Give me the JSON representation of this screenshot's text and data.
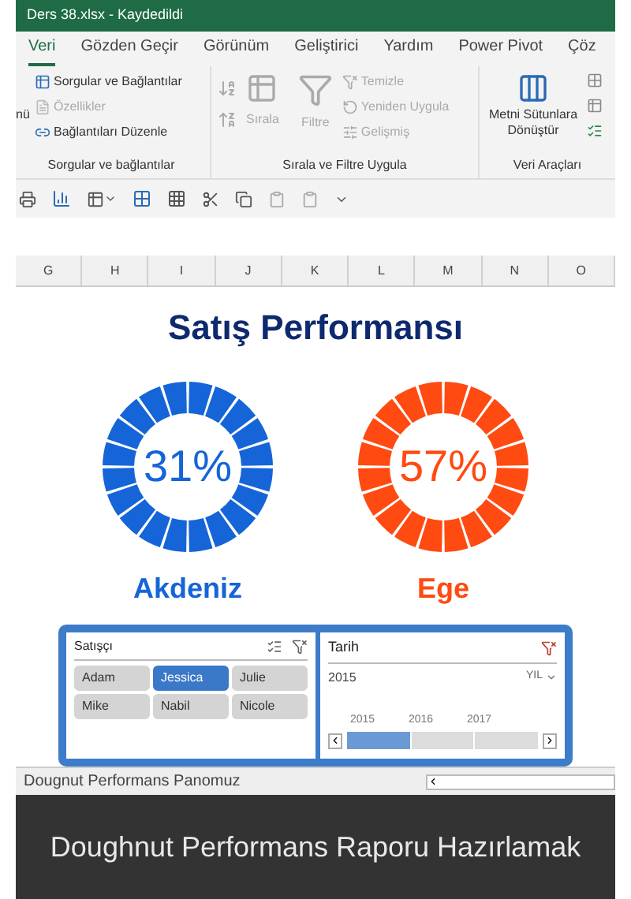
{
  "window": {
    "title": "Ders 38.xlsx - Kaydedildi"
  },
  "ribbon_tabs": [
    {
      "label": "Veri",
      "selected": true
    },
    {
      "label": "Gözden Geçir",
      "selected": false
    },
    {
      "label": "Görünüm",
      "selected": false
    },
    {
      "label": "Geliştirici",
      "selected": false
    },
    {
      "label": "Yardım",
      "selected": false
    },
    {
      "label": "Power Pivot",
      "selected": false
    },
    {
      "label": "Çöz",
      "selected": false
    }
  ],
  "ribbon": {
    "cut_label": "nü",
    "queries": {
      "title": "Sorgular ve bağlantılar",
      "items": [
        {
          "label": "Sorgular ve Bağlantılar",
          "disabled": false
        },
        {
          "label": "Özellikler",
          "disabled": true
        },
        {
          "label": "Bağlantıları Düzenle",
          "disabled": false
        }
      ]
    },
    "sort_filter": {
      "title": "Sırala ve Filtre Uygula",
      "sort": "Sırala",
      "filter": "Filtre",
      "items": [
        {
          "label": "Temizle",
          "disabled": true
        },
        {
          "label": "Yeniden Uygula",
          "disabled": true
        },
        {
          "label": "Gelişmiş",
          "disabled": true
        }
      ]
    },
    "data_tools": {
      "title": "Veri Araçları",
      "text_to_columns": "Metni Sütunlara Dönüştür"
    }
  },
  "columns": [
    "G",
    "H",
    "I",
    "J",
    "K",
    "L",
    "M",
    "N",
    "O"
  ],
  "dashboard": {
    "title": "Satış Performansı",
    "gauges": [
      {
        "value": "31%",
        "label": "Akdeniz",
        "color": "#1565d8"
      },
      {
        "value": "57%",
        "label": "Ege",
        "color": "#ff4a12"
      }
    ]
  },
  "slicer": {
    "title": "Satışçı",
    "items": [
      {
        "label": "Adam",
        "selected": false
      },
      {
        "label": "Jessica",
        "selected": true
      },
      {
        "label": "Julie",
        "selected": false
      },
      {
        "label": "Mike",
        "selected": false
      },
      {
        "label": "Nabil",
        "selected": false
      },
      {
        "label": "Nicole",
        "selected": false
      }
    ]
  },
  "timeline": {
    "title": "Tarih",
    "period": "2015",
    "level": "YIL",
    "years": [
      {
        "label": "2015",
        "selected": true
      },
      {
        "label": "2016",
        "selected": false
      },
      {
        "label": "2017",
        "selected": false
      }
    ]
  },
  "sheet_tab": "Dougnut Performans Panomuz",
  "caption": "Doughnut Performans Raporu Hazırlamak"
}
